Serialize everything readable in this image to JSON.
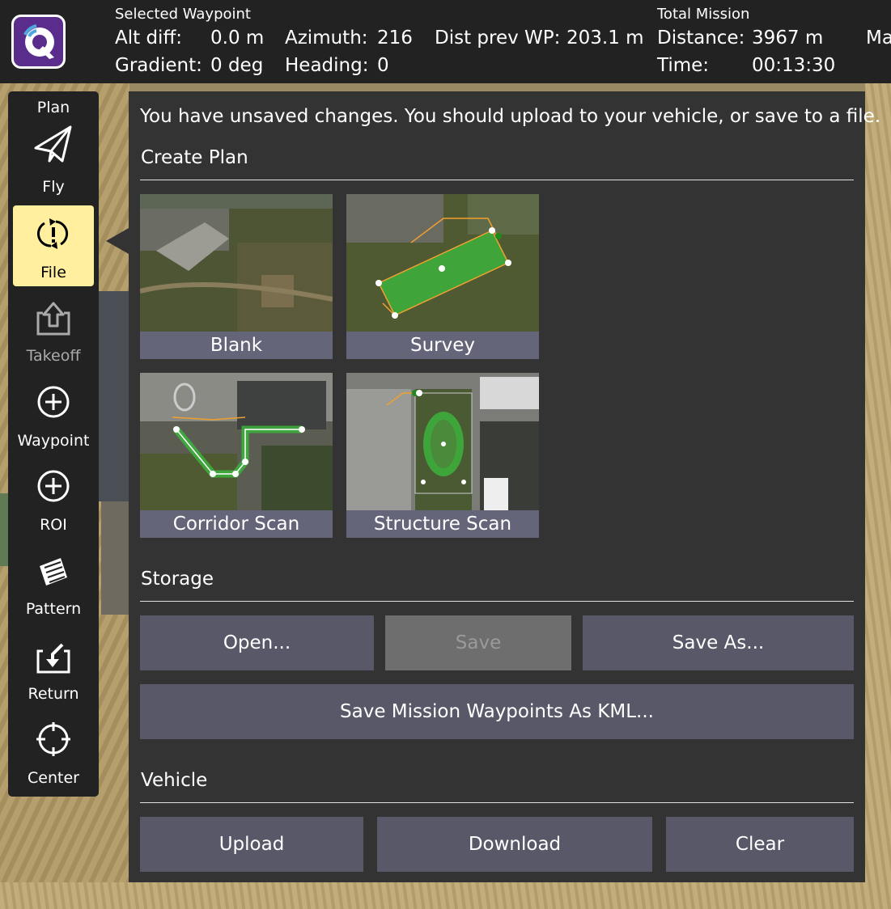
{
  "header": {
    "selected_waypoint_title": "Selected Waypoint",
    "alt_diff_label": "Alt diff:",
    "alt_diff_value": "0.0 m",
    "gradient_label": "Gradient:",
    "gradient_value": "0 deg",
    "azimuth_label": "Azimuth:",
    "azimuth_value": "216",
    "heading_label": "Heading:",
    "heading_value": "0",
    "dist_prev_label": "Dist prev WP:",
    "dist_prev_value": "203.1 m",
    "total_mission_title": "Total Mission",
    "distance_label": "Distance:",
    "distance_value": "3967 m",
    "time_label": "Time:",
    "time_value": "00:13:30",
    "truncated_label": "Ma"
  },
  "toolbar": {
    "items": [
      {
        "label": "Plan",
        "icon": "plan-title"
      },
      {
        "label": "Fly",
        "icon": "paper-plane-icon"
      },
      {
        "label": "File",
        "icon": "file-sync-icon",
        "active": true
      },
      {
        "label": "Takeoff",
        "icon": "takeoff-icon",
        "disabled": true
      },
      {
        "label": "Waypoint",
        "icon": "plus-circle-icon"
      },
      {
        "label": "ROI",
        "icon": "plus-circle-icon"
      },
      {
        "label": "Pattern",
        "icon": "pattern-icon"
      },
      {
        "label": "Return",
        "icon": "return-icon"
      },
      {
        "label": "Center",
        "icon": "crosshair-icon"
      }
    ]
  },
  "panel": {
    "unsaved_message": "You have unsaved changes. You should upload to your vehicle, or save to a file.",
    "create_plan_title": "Create Plan",
    "templates": [
      {
        "label": "Blank"
      },
      {
        "label": "Survey"
      },
      {
        "label": "Corridor Scan"
      },
      {
        "label": "Structure Scan"
      }
    ],
    "storage_title": "Storage",
    "open_label": "Open...",
    "save_label": "Save",
    "save_as_label": "Save As...",
    "save_kml_label": "Save Mission Waypoints As KML...",
    "vehicle_title": "Vehicle",
    "upload_label": "Upload",
    "download_label": "Download",
    "clear_label": "Clear"
  },
  "colors": {
    "accent_active": "#ffef9e",
    "button_bg": "#585868",
    "panel_bg": "#333333",
    "bar_bg": "#222222",
    "logo_purple": "#5a2d8c",
    "survey_green": "#3cb33c"
  }
}
